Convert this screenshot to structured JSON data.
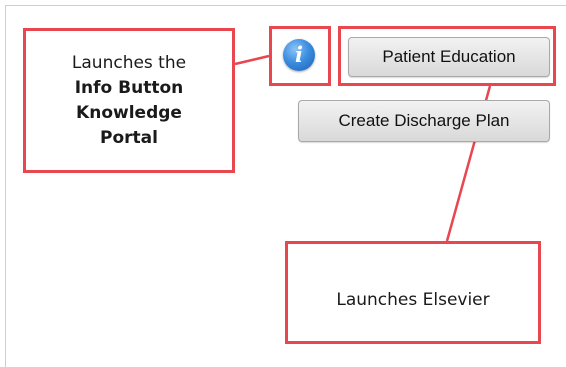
{
  "callouts": {
    "info": {
      "line1": "Launches the",
      "line2": "Info Button",
      "line3": "Knowledge",
      "line4": "Portal"
    },
    "elsevier": "Launches Elsevier"
  },
  "buttons": {
    "info_icon_glyph": "i",
    "patient_education": "Patient Education",
    "create_discharge_plan": "Create Discharge Plan"
  },
  "colors": {
    "callout_border": "#e8474f",
    "button_bg": "#e3e3e3",
    "info_icon": "#3c8ee0"
  },
  "icons": {
    "info_icon": "info-icon"
  }
}
